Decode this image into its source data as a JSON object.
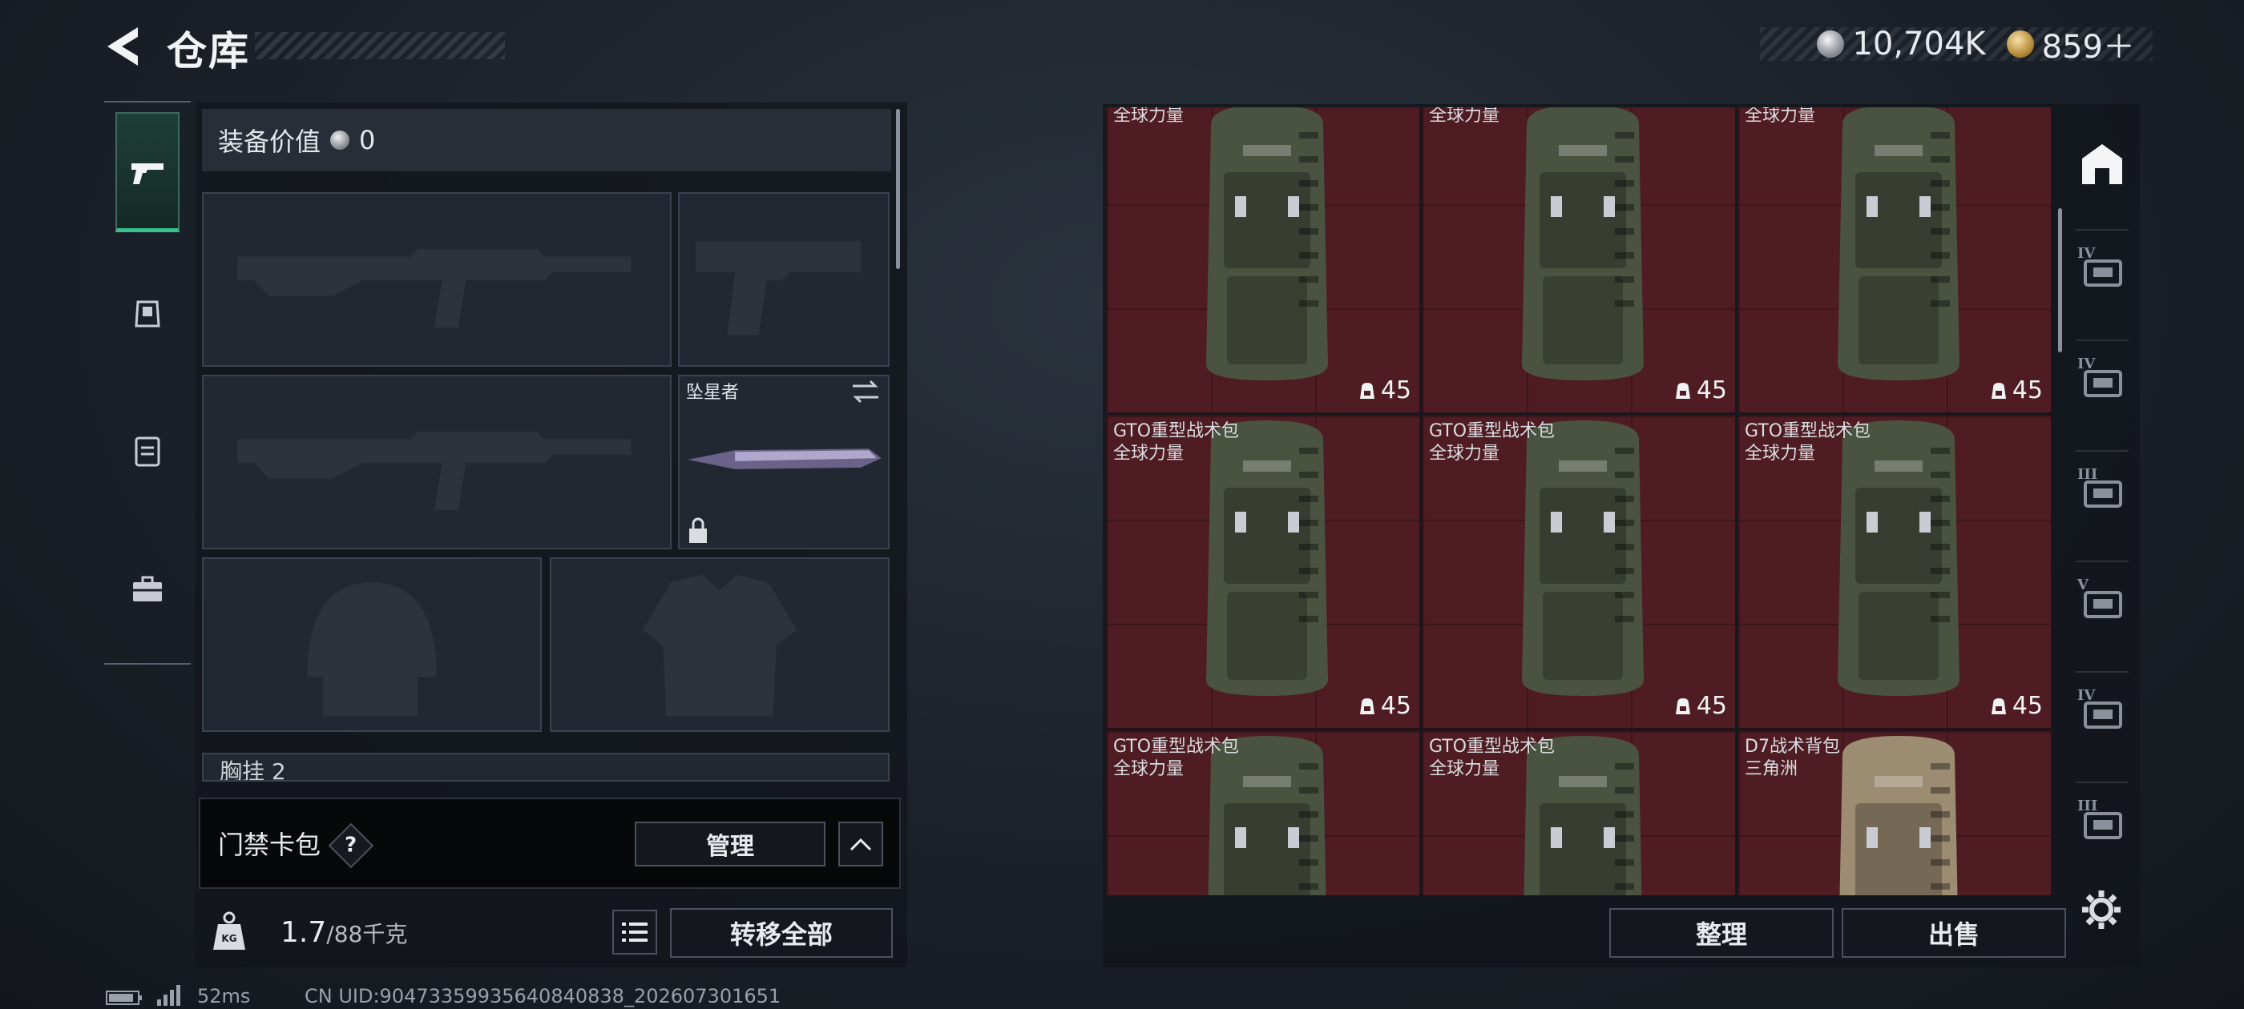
{
  "header": {
    "title": "仓库",
    "currency_silver": "10,704K",
    "currency_gold": "859＋"
  },
  "equipment": {
    "value_label": "装备价值",
    "value": "0",
    "melee_name": "坠星者",
    "chest_rig_label": "胸挂",
    "chest_rig_count": "2"
  },
  "keycard": {
    "label": "门禁卡包",
    "help": "?",
    "manage_label": "管理"
  },
  "carry": {
    "weight_current": "1.7",
    "weight_max": "/88千克",
    "weight_badge": "KG",
    "transfer_all_label": "转移全部"
  },
  "storage": {
    "items": [
      {
        "name": "",
        "tag": "全球力量",
        "count": "45",
        "color": "#4a5240"
      },
      {
        "name": "",
        "tag": "全球力量",
        "count": "45",
        "color": "#4a5240"
      },
      {
        "name": "",
        "tag": "全球力量",
        "count": "45",
        "color": "#4a5240"
      },
      {
        "name": "GTO重型战术包",
        "tag": "全球力量",
        "count": "45",
        "color": "#4a5240"
      },
      {
        "name": "GTO重型战术包",
        "tag": "全球力量",
        "count": "45",
        "color": "#4a5240"
      },
      {
        "name": "GTO重型战术包",
        "tag": "全球力量",
        "count": "45",
        "color": "#4a5240"
      },
      {
        "name": "GTO重型战术包",
        "tag": "全球力量",
        "count": "",
        "color": "#4a5240"
      },
      {
        "name": "GTO重型战术包",
        "tag": "全球力量",
        "count": "",
        "color": "#4a5240"
      },
      {
        "name": "D7战术背包",
        "tag": "三角洲",
        "count": "",
        "color": "#9c8c72"
      }
    ],
    "sort_label": "整理",
    "sell_label": "出售"
  },
  "rail": {
    "tiers": [
      "IV",
      "IV",
      "III",
      "V",
      "IV",
      "III"
    ]
  },
  "status": {
    "ping": "52ms",
    "uid": "CN UID:9047335993564084083​8_202607301651"
  },
  "colors": {
    "accent_green": "#36c08e",
    "storage_red": "#4e1c22"
  }
}
